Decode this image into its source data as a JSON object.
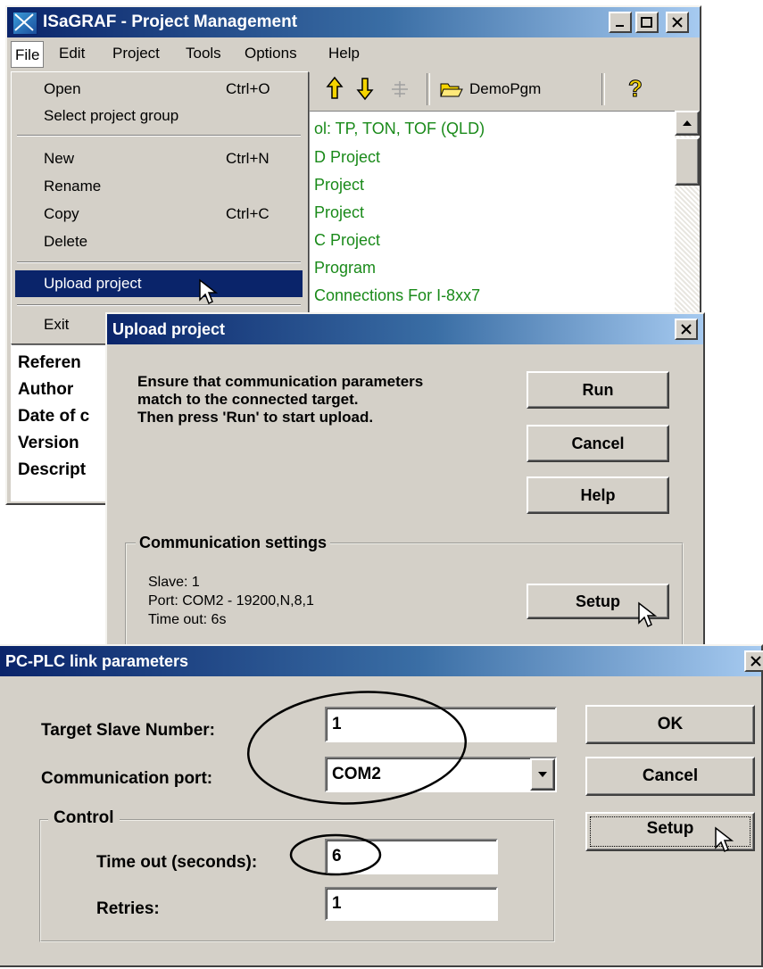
{
  "main_window": {
    "title": "ISaGRAF - Project Management",
    "menu": [
      "File",
      "Edit",
      "Project",
      "Tools",
      "Options",
      "Help"
    ],
    "toolbar": {
      "group": "DemoPgm"
    },
    "project_list": [
      "ol:  TP, TON, TOF  (QLD)",
      "D Project",
      " Project",
      "Project",
      "C Project",
      "Program",
      " Connections For I-8xx7"
    ],
    "info_labels": [
      "Referen",
      "Author",
      "Date of c",
      "Version",
      "Descript"
    ]
  },
  "file_menu": {
    "items": [
      {
        "label": "Open",
        "shortcut": "Ctrl+O"
      },
      {
        "label": "Select project group",
        "shortcut": ""
      },
      {
        "label": "New",
        "shortcut": "Ctrl+N"
      },
      {
        "label": "Rename",
        "shortcut": ""
      },
      {
        "label": "Copy",
        "shortcut": "Ctrl+C"
      },
      {
        "label": "Delete",
        "shortcut": ""
      },
      {
        "label": "Upload project",
        "shortcut": ""
      },
      {
        "label": "Exit",
        "shortcut": ""
      }
    ]
  },
  "upload_dialog": {
    "title": "Upload project",
    "message": [
      "Ensure that communication parameters",
      "match to the connected target.",
      "Then press 'Run' to start upload."
    ],
    "buttons": {
      "run": "Run",
      "cancel": "Cancel",
      "help": "Help",
      "setup": "Setup"
    },
    "comm_group": "Communication settings",
    "comm_lines": [
      "Slave: 1",
      "Port: COM2 - 19200,N,8,1",
      "Time out: 6s"
    ]
  },
  "link_dialog": {
    "title": "PC-PLC link parameters",
    "target_slave_label": "Target Slave Number:",
    "target_slave_value": "1",
    "comm_port_label": "Communication port:",
    "comm_port_value": "COM2",
    "control_group": "Control",
    "timeout_label": "Time out (seconds):",
    "timeout_value": "6",
    "retries_label": "Retries:",
    "retries_value": "1",
    "buttons": {
      "ok": "OK",
      "cancel": "Cancel",
      "setup": "Setup"
    }
  },
  "colors": {
    "titlebar": "#0a246a",
    "menu_highlight": "#0a246a",
    "list_text": "#1a8a1a",
    "face": "#d4d0c8"
  }
}
